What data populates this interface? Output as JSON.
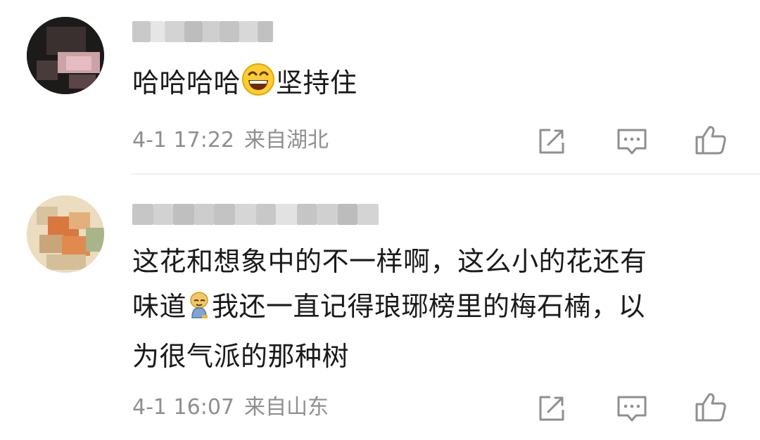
{
  "comments": [
    {
      "text_a": "哈哈哈哈",
      "emoji": "grinning-face",
      "text_b": "坚持住",
      "time": "4-1 17:22",
      "location": "来自湖北",
      "actions": [
        "share-icon",
        "comment-icon",
        "like-icon"
      ]
    },
    {
      "line1": "这花和想象中的不一样啊，这么小的花还有",
      "line2_a": "味道",
      "emoji": "doge-figure",
      "line2_b": "我还一直记得琅琊榜里的梅石楠，以",
      "line3": "为很气派的那种树",
      "time": "4-1 16:07",
      "location": "来自山东",
      "actions": [
        "share-icon",
        "comment-icon",
        "like-icon"
      ]
    }
  ]
}
